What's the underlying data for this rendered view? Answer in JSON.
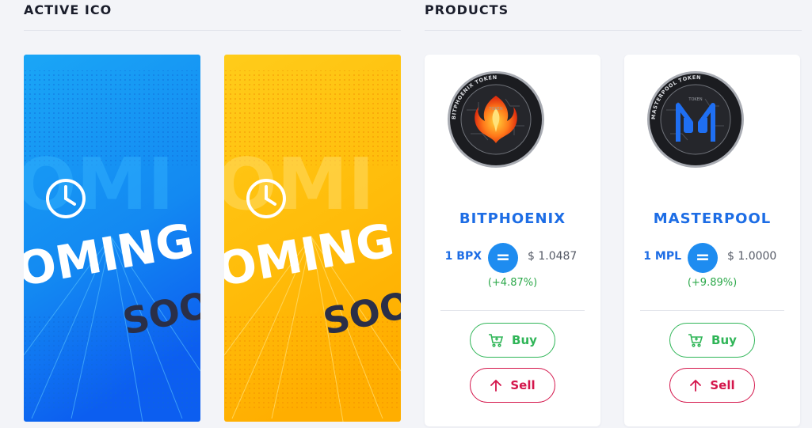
{
  "sections": {
    "active_ico_title": "ACTIVE ICO",
    "products_title": "PRODUCTS"
  },
  "ico_cards": [
    {
      "overlay_text_1": "OMING",
      "overlay_text_2": "SOO",
      "theme_color": "#1a9cf5",
      "icon": "clock-icon"
    },
    {
      "overlay_text_1": "OMING",
      "overlay_text_2": "SOO",
      "theme_color": "#ffc31a",
      "icon": "clock-icon"
    }
  ],
  "products": [
    {
      "coin_label": "BITPHOENIX TOKEN",
      "name": "BITPHOENIX",
      "unit": "1 BPX",
      "equals": "=",
      "price": "$ 1.0487",
      "change": "(+4.87%)",
      "buy_label": "Buy",
      "sell_label": "Sell",
      "coin_icon": "phoenix-icon"
    },
    {
      "coin_label": "MASTERPOOL TOKEN",
      "name": "MASTERPOOL",
      "unit": "1 MPL",
      "equals": "=",
      "price": "$ 1.0000",
      "change": "(+9.89%)",
      "buy_label": "Buy",
      "sell_label": "Sell",
      "coin_icon": "masterpool-m-icon"
    }
  ],
  "colors": {
    "accent_blue": "#1d6de5",
    "buy_green": "#2fb557",
    "sell_red": "#d4154b",
    "change_green": "#2ca84a"
  }
}
